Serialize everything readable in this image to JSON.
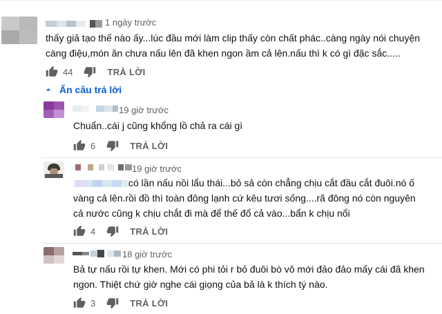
{
  "colors": {
    "accent": "#065fd4",
    "muted": "#606060",
    "text": "#0f0f0f"
  },
  "main_comment": {
    "time": "1 ngày trước",
    "text_line1": "thấy giả tạo thế nào ấy...lúc đầu mới làm clip thấy còn chất phác..càng ngày nói chuyện",
    "text_line2": "càng điệu,món ăn chưa nấu lên đã khen ngon ầm cả lên.nấu thì k có gì đặc sắc.....",
    "likes": "44",
    "reply_label": "TRẢ LỜI"
  },
  "hide_replies_label": "Ẩn câu trả lời",
  "replies": [
    {
      "time": "19 giờ trước",
      "text_line1": "Chuẩn..cái j cũng khổng lồ chả ra cái gì",
      "likes": "6",
      "reply_label": "TRẢ LỜI"
    },
    {
      "time": "19 giờ trước",
      "text_line1": "có lần nấu nồi lẩu thái...bỏ sả còn chẳng chịu cắt đầu cắt đuôi.nó ố",
      "text_line2": "vàng cả lên.rồi đồ thì toàn đông lạnh cứ kêu tươi sống....rã đông nó còn nguyên",
      "text_line3": "cả nước cũng k chịu chắt đi mà để thế đổ cả vào...bẩn k chịu nổi",
      "likes": "4",
      "reply_label": "TRẢ LỜI"
    },
    {
      "time": "18 giờ trước",
      "text_line1": "Bả tự nấu rồi tự khen. Mới có phi tỏi r bỏ đuôi bò vô mới đảo đảo mấy cái đã khen",
      "text_line2": "ngon. Thiệt chứ giờ nghe cái giọng của bả là k thích tý nào.",
      "likes": "3",
      "reply_label": "TRẢ LỜI"
    }
  ],
  "icons": [
    "like-icon",
    "dislike-icon",
    "chevron-up-icon"
  ]
}
